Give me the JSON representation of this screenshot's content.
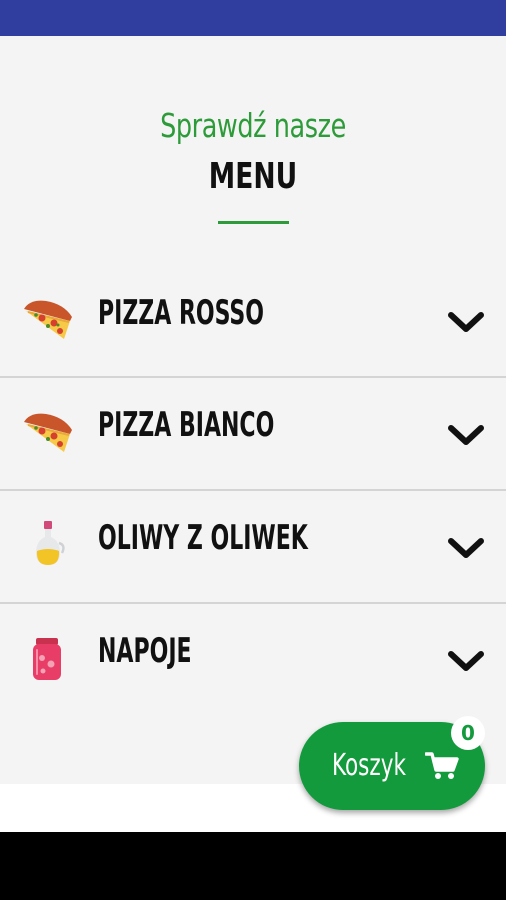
{
  "header": {
    "subtitle": "Sprawdź nasze",
    "title": "MENU"
  },
  "menu": {
    "items": [
      {
        "label": "PIZZA ROSSO",
        "icon": "pizza-slice-icon"
      },
      {
        "label": "PIZZA BIANCO",
        "icon": "pizza-slice-icon"
      },
      {
        "label": "OLIWY Z OLIWEK",
        "icon": "olive-oil-bottle-icon"
      },
      {
        "label": "NAPOJE",
        "icon": "drink-jar-icon"
      }
    ]
  },
  "cart": {
    "label": "Koszyk",
    "count": "0",
    "icon": "shopping-cart-icon"
  },
  "colors": {
    "status_bar": "#303f9f",
    "accent_green": "#2e9b3a",
    "cart_button": "#139a3c"
  }
}
